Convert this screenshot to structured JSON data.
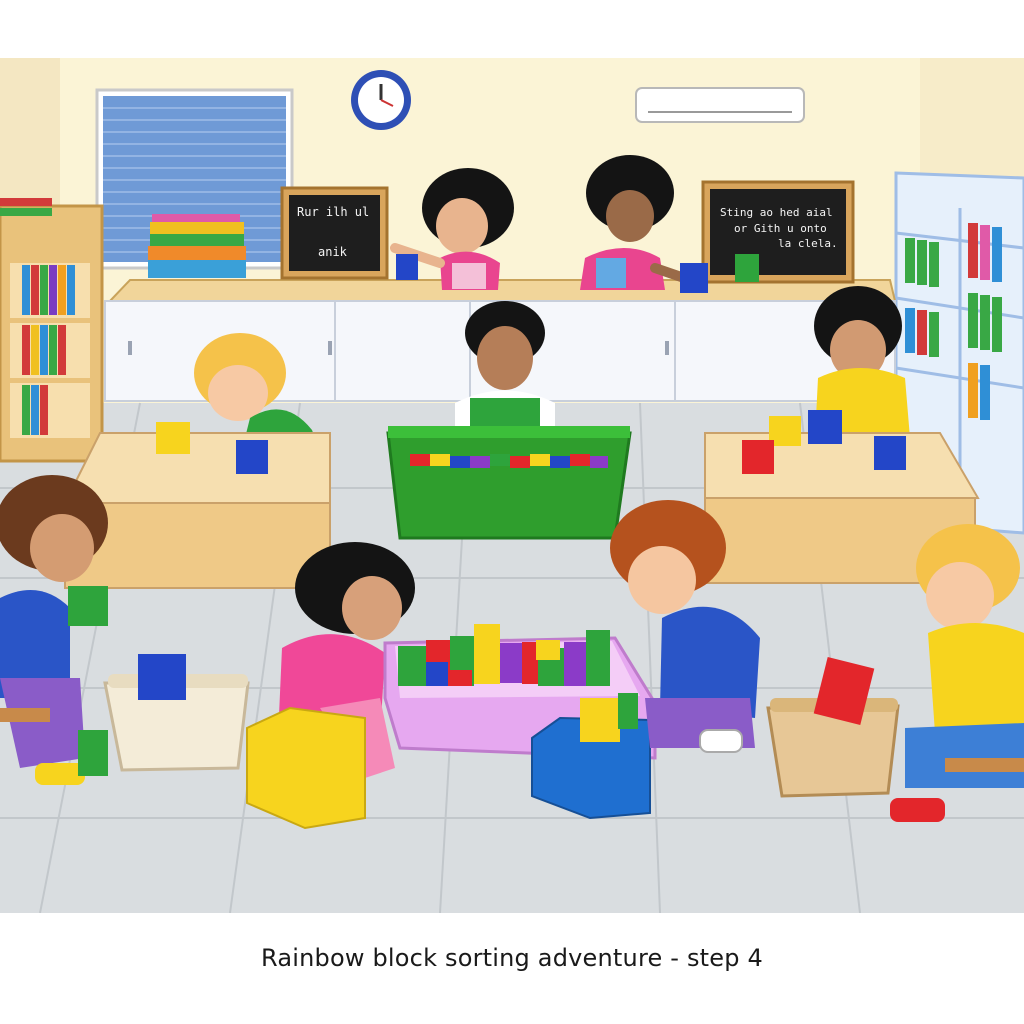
{
  "scene": {
    "board_left_lines": [
      "Rur ilh ul",
      "anik"
    ],
    "board_right_lines": [
      "Sting ao hed aial",
      "or Gith u onto",
      "la clela."
    ]
  },
  "caption": "Rainbow block sorting adventure - step 4",
  "colors": {
    "wall": "#fbf4d6",
    "floor": "#d9dde0",
    "counter": "#f1d59a",
    "cabinet": "#f5f7fb",
    "block_red": "#e3262b",
    "block_yellow": "#f7d41e",
    "block_green": "#2ea43c",
    "block_blue": "#2346c8",
    "block_purple": "#8b3bc8",
    "bin_green": "#2f9e2d"
  }
}
